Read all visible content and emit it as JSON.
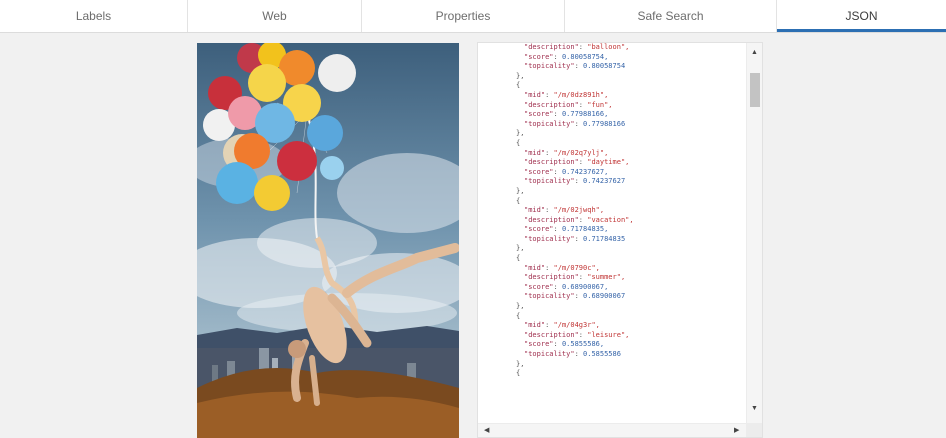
{
  "tabs": [
    {
      "label": "Labels"
    },
    {
      "label": "Web"
    },
    {
      "label": "Properties"
    },
    {
      "label": "Safe Search"
    },
    {
      "label": "JSON"
    }
  ],
  "active_tab": "JSON",
  "accent_color": "#2c6fb3",
  "json_lines": [
    {
      "k": "\"description\"",
      "v": "\"balloon\",",
      "t": "str"
    },
    {
      "k": "\"score\"",
      "v": "0.80058754,",
      "t": "num"
    },
    {
      "k": "\"topicality\"",
      "v": "0.80058754",
      "t": "num"
    },
    {
      "p": "},"
    },
    {
      "p": "{"
    },
    {
      "k": "\"mid\"",
      "v": "\"/m/0dz891h\",",
      "t": "str"
    },
    {
      "k": "\"description\"",
      "v": "\"fun\",",
      "t": "str"
    },
    {
      "k": "\"score\"",
      "v": "0.77988166,",
      "t": "num"
    },
    {
      "k": "\"topicality\"",
      "v": "0.77988166",
      "t": "num"
    },
    {
      "p": "},"
    },
    {
      "p": "{"
    },
    {
      "k": "\"mid\"",
      "v": "\"/m/02q7ylj\",",
      "t": "str"
    },
    {
      "k": "\"description\"",
      "v": "\"daytime\",",
      "t": "str"
    },
    {
      "k": "\"score\"",
      "v": "0.74237627,",
      "t": "num"
    },
    {
      "k": "\"topicality\"",
      "v": "0.74237627",
      "t": "num"
    },
    {
      "p": "},"
    },
    {
      "p": "{"
    },
    {
      "k": "\"mid\"",
      "v": "\"/m/02jwqh\",",
      "t": "str"
    },
    {
      "k": "\"description\"",
      "v": "\"vacation\",",
      "t": "str"
    },
    {
      "k": "\"score\"",
      "v": "0.71784835,",
      "t": "num"
    },
    {
      "k": "\"topicality\"",
      "v": "0.71784835",
      "t": "num"
    },
    {
      "p": "},"
    },
    {
      "p": "{"
    },
    {
      "k": "\"mid\"",
      "v": "\"/m/0790c\",",
      "t": "str"
    },
    {
      "k": "\"description\"",
      "v": "\"summer\",",
      "t": "str"
    },
    {
      "k": "\"score\"",
      "v": "0.68900067,",
      "t": "num"
    },
    {
      "k": "\"topicality\"",
      "v": "0.68900067",
      "t": "num"
    },
    {
      "p": "},"
    },
    {
      "p": "{"
    },
    {
      "k": "\"mid\"",
      "v": "\"/m/04g3r\",",
      "t": "str"
    },
    {
      "k": "\"description\"",
      "v": "\"leisure\",",
      "t": "str"
    },
    {
      "k": "\"score\"",
      "v": "0.5855586,",
      "t": "num"
    },
    {
      "k": "\"topicality\"",
      "v": "0.5855586",
      "t": "num"
    },
    {
      "p": "},"
    },
    {
      "p": "{"
    }
  ]
}
